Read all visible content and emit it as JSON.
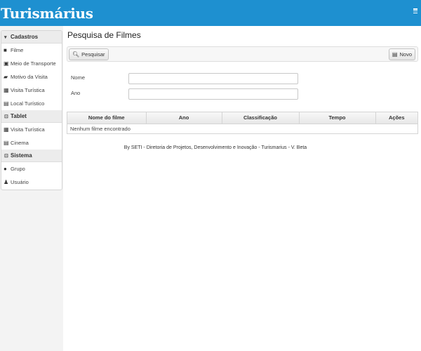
{
  "app": {
    "title": "Turismárius"
  },
  "sidebar": {
    "sections": [
      {
        "title": "Cadastros",
        "icon": "caret-down-icon",
        "items": [
          {
            "label": "Filme",
            "icon": "video-camera-icon"
          },
          {
            "label": "Meio de Transporte",
            "icon": "bus-icon"
          },
          {
            "label": "Motivo da Visita",
            "icon": "book-icon"
          },
          {
            "label": "Visita Turística",
            "icon": "calendar-icon"
          },
          {
            "label": "Local Turístico",
            "icon": "list-icon"
          }
        ]
      },
      {
        "title": "Tablet",
        "icon": "share-box-icon",
        "items": [
          {
            "label": "Visita Turística",
            "icon": "calendar-icon"
          },
          {
            "label": "Cinema",
            "icon": "document-icon"
          }
        ]
      },
      {
        "title": "Sistema",
        "icon": "share-box-icon",
        "items": [
          {
            "label": "Grupo",
            "icon": "group-icon"
          },
          {
            "label": "Usuário",
            "icon": "user-icon"
          }
        ]
      }
    ]
  },
  "main": {
    "title": "Pesquisa de Filmes",
    "toolbar": {
      "search_label": "Pesquisar",
      "new_label": "Novo"
    },
    "form": {
      "name_label": "Nome",
      "name_value": "",
      "year_label": "Ano",
      "year_value": ""
    },
    "grid": {
      "columns": [
        "Nome do filme",
        "Ano",
        "Classificação",
        "Tempo",
        "Ações"
      ],
      "empty_message": "Nenhum filme encontrado"
    }
  },
  "footer": {
    "text": "By SETI - Diretoria de Projetos, Desenvolvimento e Inovação - Turismarius - V. Beta"
  },
  "colors": {
    "header": "#1e90d0",
    "sidebar_bg": "#f3f3f3"
  }
}
